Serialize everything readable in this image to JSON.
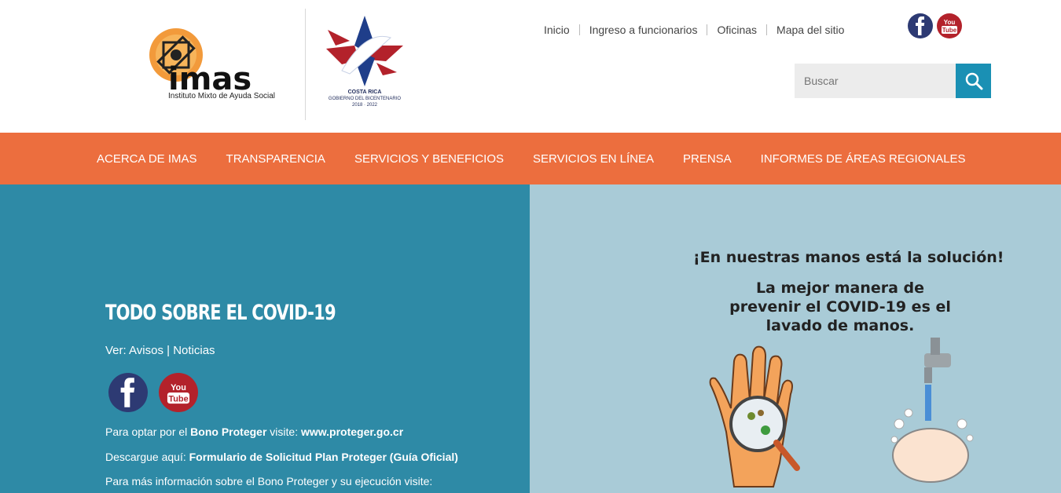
{
  "header": {
    "imas_logo_text": "imas",
    "imas_subtitle": "Instituto Mixto de Ayuda Social",
    "gov_logo": {
      "line1": "COSTA RICA",
      "line2": "GOBIERNO DEL BICENTENARIO",
      "line3": "2018 · 2022"
    },
    "top_links": [
      "Inicio",
      "Ingreso a funcionarios",
      "Oficinas",
      "Mapa del sitio"
    ],
    "social": [
      {
        "icon": "facebook-icon",
        "color": "#2d3a73"
      },
      {
        "icon": "youtube-icon",
        "color": "#b3222b",
        "label": "You Tube"
      }
    ],
    "search": {
      "placeholder": "Buscar",
      "icon": "search-icon",
      "button_color": "#1a90b4"
    }
  },
  "nav": {
    "color": "#ec6e3e",
    "items": [
      "ACERCA DE IMAS",
      "TRANSPARENCIA",
      "SERVICIOS Y BENEFICIOS",
      "SERVICIOS EN LÍNEA",
      "PRENSA",
      "INFORMES DE ÁREAS REGIONALES"
    ]
  },
  "covid": {
    "title": "TODO SOBRE EL COVID-19",
    "ver_prefix": "Ver: ",
    "link_avisos": "Avisos",
    "ver_sep": " | ",
    "link_noticias": "Noticias",
    "bono_prefix": "Para optar por el ",
    "bono_name": "Bono Proteger",
    "bono_mid": " visite: ",
    "bono_url": "www.proteger.go.cr",
    "form_prefix": "Descargue aquí: ",
    "form_link": "Formulario de Solicitud Plan Proteger (Guía Oficial)",
    "more_info": "Para más información sobre el Bono Proteger y su ejecución visite:"
  },
  "promo": {
    "headline": "¡En nuestras manos está la solución!",
    "subline": "La mejor manera de prevenir el COVID-19 es el lavado de manos."
  }
}
